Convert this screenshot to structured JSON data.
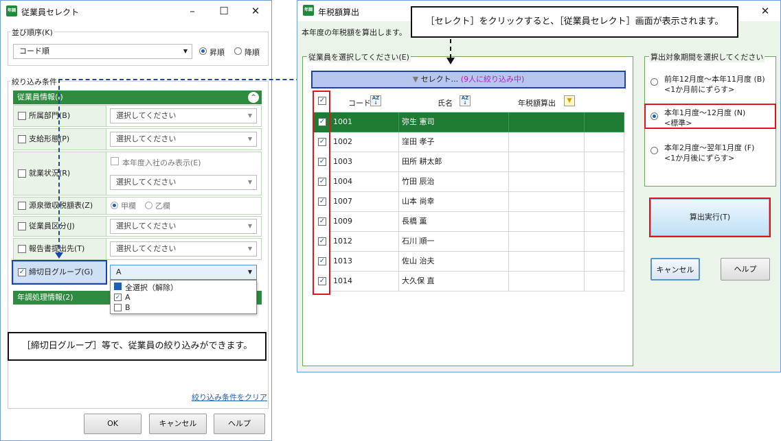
{
  "left_window": {
    "title": "従業員セレクト",
    "sort_group_title": "並び順序(K)",
    "sort_value": "コード順",
    "sort_asc": "昇順",
    "sort_desc": "降順",
    "filter_group_title": "絞り込み条件",
    "employee_info_header": "従業員情報(I)",
    "rows": {
      "dept_label": "所属部門(B)",
      "dept_value": "選択してください",
      "pay_label": "支給形態(P)",
      "pay_value": "選択してください",
      "status_label": "就業状況(R)",
      "status_check": "本年度入社のみ表示(E)",
      "status_value": "選択してください",
      "withholding_label": "源泉徴収税額表(Z)",
      "withholding_opt1": "甲欄",
      "withholding_opt2": "乙欄",
      "category_label": "従業員区分(J)",
      "category_value": "選択してください",
      "report_label": "報告書提出先(T)",
      "report_value": "選択してください",
      "closing_label": "締切日グループ(G)",
      "closing_value": "A"
    },
    "dropdown": {
      "select_all": "全選択（解除）",
      "opt_a": "A",
      "opt_b": "B"
    },
    "year_end_header": "年調処理情報(2)",
    "clear_link": "絞り込み条件をクリア",
    "ok": "OK",
    "cancel": "キャンセル",
    "help": "ヘルプ"
  },
  "callout_left": "［締切日グループ］等で、従業員の絞り込みができます。",
  "callout_right": "［セレクト］をクリックすると、［従業員セレクト］画面が表示されます。",
  "right_window": {
    "app_badge": "年調",
    "title": "年税額算出",
    "subtitle": "本年度の年税額を算出します。",
    "employee_group_title": "従業員を選択してください(E)",
    "select_button": "セレクト...",
    "select_count": "(9人に絞り込み中)",
    "col_code": "コード",
    "col_name": "氏名",
    "col_tax": "年税額算出",
    "employees": [
      {
        "code": "1001",
        "name": "弥生 憲司"
      },
      {
        "code": "1002",
        "name": "窪田 孝子"
      },
      {
        "code": "1003",
        "name": "田所 耕太郎"
      },
      {
        "code": "1004",
        "name": "竹田 辰治"
      },
      {
        "code": "1007",
        "name": "山本 尚幸"
      },
      {
        "code": "1009",
        "name": "長橋 薫"
      },
      {
        "code": "1012",
        "name": "石川 順一"
      },
      {
        "code": "1013",
        "name": "佐山 治夫"
      },
      {
        "code": "1014",
        "name": "大久保 直"
      }
    ],
    "period_group_title": "算出対象期間を選択してください",
    "period1_line1": "前年12月度～本年11月度 (B)",
    "period1_line2": "<1か月前にずらす>",
    "period2_line1": "本年1月度～12月度 (N)",
    "period2_line2": "<標準>",
    "period3_line1": "本年2月度～翌年1月度 (F)",
    "period3_line2": "<1か月後にずらす>",
    "execute": "算出実行(T)",
    "cancel": "キャンセル",
    "help": "ヘルプ"
  }
}
